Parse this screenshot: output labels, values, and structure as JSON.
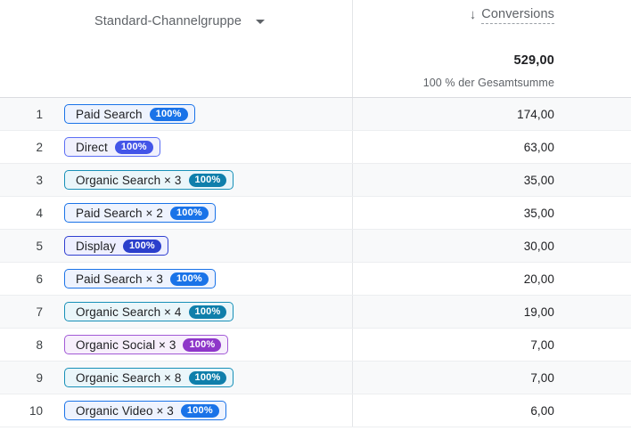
{
  "header": {
    "dimension_label": "Standard-Channelgruppe",
    "dimension_caret_icon": "chevron-down-icon",
    "sort_icon": "arrow-down-icon",
    "metric_label": "Conversions",
    "total_value": "529,00",
    "total_subtitle": "100 % der Gesamtsumme"
  },
  "colors": {
    "paid_search_border": "#1a73e8",
    "paid_search_bg": "#eef3fe",
    "paid_search_badge": "#1a73e8",
    "direct_border": "#5b6ef5",
    "direct_bg": "#f1f1fd",
    "direct_badge": "#4355e8",
    "organic_search_border": "#1790b8",
    "organic_search_bg": "#eaf6fa",
    "organic_search_badge": "#0f7fab",
    "display_border": "#2f3fd0",
    "display_bg": "#eeefff",
    "display_badge": "#2b3fcc",
    "organic_social_border": "#a25ad6",
    "organic_social_bg": "#f7effc",
    "organic_social_badge": "#8e36c9",
    "organic_video_border": "#1a73e8",
    "organic_video_bg": "#eef3fe",
    "organic_video_badge": "#1a73e8",
    "row_alt_bg": "#f8f9fa",
    "row_border": "#eceef0",
    "column_divider": "#e3e5e8",
    "text_primary": "#202124",
    "text_secondary": "#5f6368"
  },
  "chart_data": {
    "type": "table",
    "title": "Standard-Channelgruppe / Conversions",
    "columns": [
      "Standard-Channelgruppe",
      "Conversions"
    ],
    "total": 529,
    "total_label": "529,00",
    "rows": [
      {
        "index": "1",
        "chip_label": "Paid Search",
        "chip_badge": "100%",
        "chip_style": "paid_search",
        "value": "174,00",
        "value_num": 174
      },
      {
        "index": "2",
        "chip_label": "Direct",
        "chip_badge": "100%",
        "chip_style": "direct",
        "value": "63,00",
        "value_num": 63
      },
      {
        "index": "3",
        "chip_label": "Organic Search × 3",
        "chip_badge": "100%",
        "chip_style": "organic_search",
        "value": "35,00",
        "value_num": 35
      },
      {
        "index": "4",
        "chip_label": "Paid Search × 2",
        "chip_badge": "100%",
        "chip_style": "paid_search",
        "value": "35,00",
        "value_num": 35
      },
      {
        "index": "5",
        "chip_label": "Display",
        "chip_badge": "100%",
        "chip_style": "display",
        "value": "30,00",
        "value_num": 30
      },
      {
        "index": "6",
        "chip_label": "Paid Search × 3",
        "chip_badge": "100%",
        "chip_style": "paid_search",
        "value": "20,00",
        "value_num": 20
      },
      {
        "index": "7",
        "chip_label": "Organic Search × 4",
        "chip_badge": "100%",
        "chip_style": "organic_search",
        "value": "19,00",
        "value_num": 19
      },
      {
        "index": "8",
        "chip_label": "Organic Social × 3",
        "chip_badge": "100%",
        "chip_style": "organic_social",
        "value": "7,00",
        "value_num": 7
      },
      {
        "index": "9",
        "chip_label": "Organic Search × 8",
        "chip_badge": "100%",
        "chip_style": "organic_search",
        "value": "7,00",
        "value_num": 7
      },
      {
        "index": "10",
        "chip_label": "Organic Video × 3",
        "chip_badge": "100%",
        "chip_style": "organic_video",
        "value": "6,00",
        "value_num": 6
      }
    ]
  }
}
